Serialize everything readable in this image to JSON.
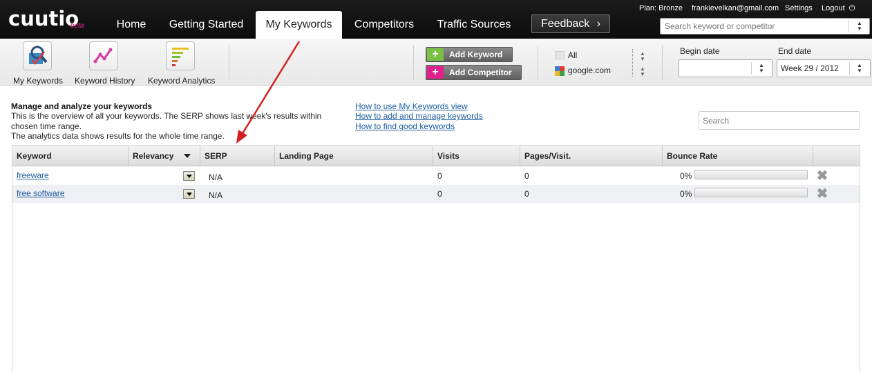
{
  "app": {
    "logo": "cuutio",
    "logo_badge": "beta"
  },
  "nav": {
    "tabs": [
      {
        "label": "Home"
      },
      {
        "label": "Getting Started"
      },
      {
        "label": "My Keywords"
      },
      {
        "label": "Competitors"
      },
      {
        "label": "Traffic Sources"
      }
    ],
    "active_tab": "My Keywords",
    "feedback_label": "Feedback"
  },
  "account": {
    "plan": "Plan: Bronze",
    "email": "frankievelkan@gmail.com",
    "settings": "Settings",
    "logout": "Logout"
  },
  "top_search": {
    "placeholder": "Search keyword or competitor"
  },
  "toolbar": {
    "tools": [
      {
        "label": "My Keywords",
        "icon": "magnifier-checklist-icon"
      },
      {
        "label": "Keyword History",
        "icon": "line-chart-icon"
      },
      {
        "label": "Keyword Analytics",
        "icon": "bar-list-icon"
      }
    ],
    "add_keyword": "Add Keyword",
    "add_competitor": "Add Competitor",
    "engines": [
      {
        "label": "All",
        "icon": "flag-icon"
      },
      {
        "label": "google.com",
        "icon": "google-icon"
      }
    ],
    "begin_date_label": "Begin date",
    "begin_date_value": "",
    "end_date_label": "End date",
    "end_date_value": "Week 29 / 2012"
  },
  "intro": {
    "title": "Manage and analyze your keywords",
    "lines": [
      "This is the overview of all your keywords. The SERP shows last week's results within",
      "chosen time range.",
      "The analytics data shows results for the whole time range."
    ]
  },
  "help_links": [
    "How to use My Keywords view",
    "How to add and manage keywords",
    "How to find good keywords"
  ],
  "content_search": {
    "placeholder": "Search"
  },
  "table": {
    "columns": [
      "Keyword",
      "Relevancy",
      "SERP",
      "Landing Page",
      "Visits",
      "Pages/Visit.",
      "Bounce Rate"
    ],
    "rows": [
      {
        "keyword": "freeware",
        "serp": "N/A",
        "landing_page": "",
        "visits": "0",
        "pages_per_visit": "0",
        "bounce_rate": "0%",
        "bounce_fraction": 0
      },
      {
        "keyword": "free software",
        "serp": "N/A",
        "landing_page": "",
        "visits": "0",
        "pages_per_visit": "0",
        "bounce_rate": "0%",
        "bounce_fraction": 0
      }
    ]
  },
  "colors": {
    "topbar": "#111111",
    "link": "#1a5c9e",
    "annotation_arrow": "#d42020",
    "add_keyword_accent": "#7ac143",
    "add_competitor_accent": "#e0208c"
  }
}
